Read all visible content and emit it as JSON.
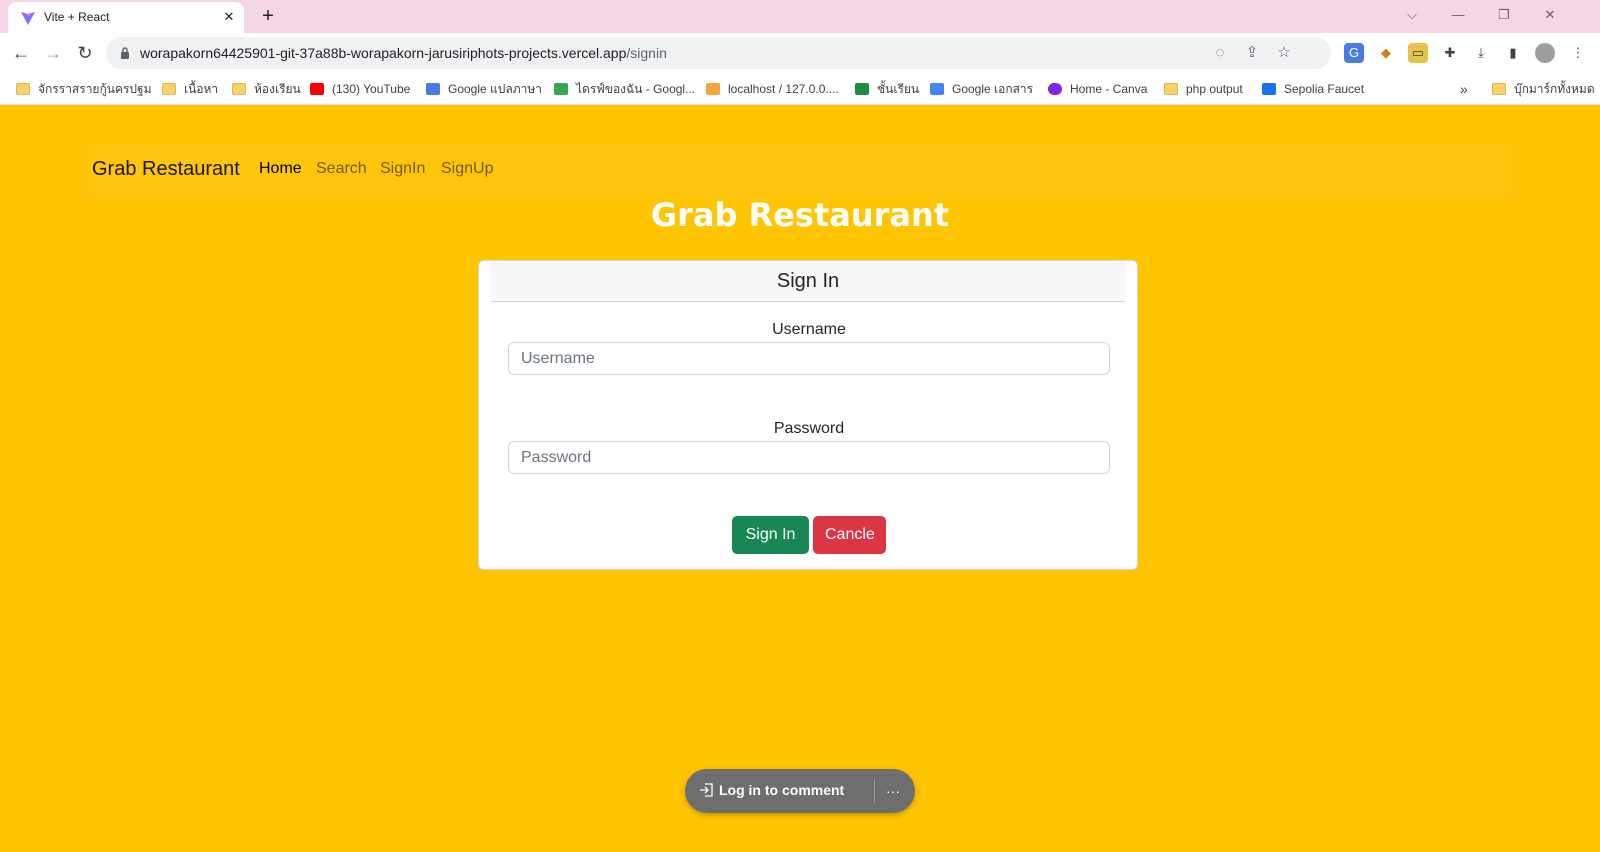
{
  "browser": {
    "tab_title": "Vite + React",
    "tab_close": "✕",
    "new_tab": "+",
    "window_controls": {
      "tab_search": "⌵",
      "minimize": "—",
      "restore": "❐",
      "close": "✕"
    },
    "nav": {
      "back": "←",
      "forward": "→",
      "reload": "↻"
    },
    "url_host": "worapakorn64425901-git-37a88b-worapakorn-jarusiriphots-projects.vercel.app",
    "url_path": "/signin",
    "omnibox_icons": [
      "eye-off-icon",
      "share-icon",
      "star-icon"
    ],
    "extensions": [
      "translate-icon",
      "metamask-icon",
      "ext-icon",
      "puzzle-icon",
      "download-icon",
      "sidepanel-icon",
      "profile-avatar",
      "menu-icon"
    ],
    "bookmarks": [
      "จักรราสรายกู้นครปฐม",
      "เนื้อหา",
      "ห้องเรียน",
      "(130) YouTube",
      "Google แปลภาษา",
      "ไดรฟ์ของฉัน - Googl...",
      "localhost / 127.0.0....",
      "ชั้นเรียน",
      "Google เอกสาร",
      "Home - Canva",
      "php output",
      "Sepolia Faucet"
    ],
    "bookmarks_overflow": "»",
    "all_bookmarks": "บุ๊กมาร์กทั้งหมด"
  },
  "site_nav": {
    "brand": "Grab Restaurant",
    "links": [
      "Home",
      "Search",
      "SignIn",
      "SignUp"
    ]
  },
  "hero_title": "Grab Restaurant",
  "signin_card": {
    "title": "Sign In",
    "username_label": "Username",
    "username_placeholder": "Username",
    "password_label": "Password",
    "password_placeholder": "Password",
    "signin_button": "Sign In",
    "cancel_button": "Cancle"
  },
  "comment_bar": {
    "login_text": "Log in to comment",
    "more": "···"
  },
  "colors": {
    "page_bg": "#ffc500",
    "signin_button": "#198754",
    "cancel_button": "#dc3545",
    "tabstrip": "#f5d6e6"
  }
}
